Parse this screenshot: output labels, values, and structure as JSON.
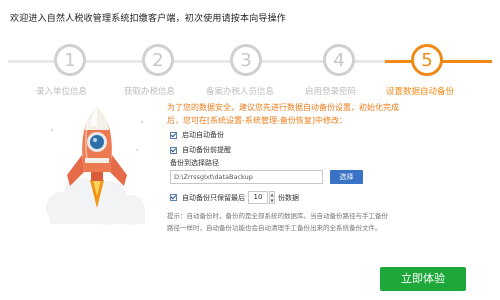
{
  "window": {
    "title": "欢迎进入自然人税收管理系统扣缴客户端，初次使用请按本向导操作"
  },
  "steps": [
    {
      "number": "1",
      "label": "录入单位信息",
      "state": "done"
    },
    {
      "number": "2",
      "label": "获取办税信息",
      "state": "done"
    },
    {
      "number": "3",
      "label": "备案办税人员信息",
      "state": "done"
    },
    {
      "number": "4",
      "label": "启用登录密码",
      "state": "done"
    },
    {
      "number": "5",
      "label": "设置数据自动备份",
      "state": "active"
    }
  ],
  "colors": {
    "accent": "#f08a16",
    "inactive": "#d0d0d0",
    "primary_button": "#1ea83a",
    "choose_button": "#3a73c6"
  },
  "backup": {
    "intro_line1": "为了您的数据安全，建议您先进行数据自动备份设置，初始化完成",
    "intro_line2": "后，您可在[系统设置-系统管理-备份恢复]中修改：",
    "auto_backup_label": "启动自动备份",
    "auto_backup_checked": true,
    "before_backup_remind_label": "自动备份前提醒",
    "before_backup_remind_checked": true,
    "path_label": "备份到选择路径",
    "path_value": "D:\\Zrrssglxt\\dataBackup",
    "choose_button": "选择",
    "keep_checked": true,
    "keep_prefix": "自动备份只保留最后",
    "keep_count": "10",
    "keep_suffix": "份数据",
    "tip_line1": "提示：自动备份时，备份的是全部系统的数据库。当自动备份路径与手工备份",
    "tip_line2": "路径一样时，自动备份功能也会自动清理手工备份出来的全系统备份文件。"
  },
  "actions": {
    "start_button": "立即体验"
  },
  "illustration": {
    "icon": "rocket-icon"
  }
}
